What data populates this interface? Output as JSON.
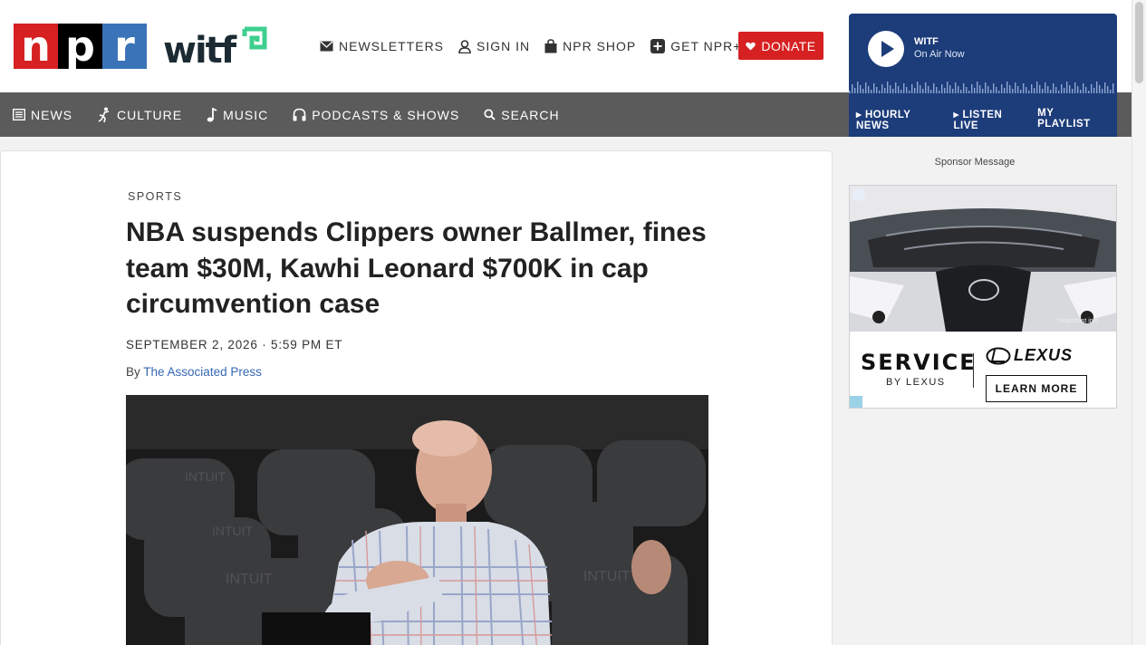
{
  "header": {
    "npr_logo": [
      "n",
      "p",
      "r"
    ],
    "station_logo": "witf",
    "util_nav": [
      {
        "label": "NEWSLETTERS",
        "icon": "mail-icon"
      },
      {
        "label": "SIGN IN",
        "icon": "user-icon"
      },
      {
        "label": "NPR SHOP",
        "icon": "shopping-bag-icon"
      },
      {
        "label": "GET NPR+",
        "icon": "plus-square-icon"
      }
    ],
    "donate_label": "DONATE"
  },
  "nav": {
    "items": [
      {
        "label": "NEWS",
        "icon": "news-icon"
      },
      {
        "label": "CULTURE",
        "icon": "culture-icon"
      },
      {
        "label": "MUSIC",
        "icon": "music-note-icon"
      },
      {
        "label": "PODCASTS & SHOWS",
        "icon": "headphones-icon"
      },
      {
        "label": "SEARCH",
        "icon": "search-icon"
      }
    ]
  },
  "player": {
    "station": "WITF",
    "status": "On Air Now",
    "links": [
      "▸ HOURLY NEWS",
      "▸ LISTEN LIVE",
      "MY PLAYLIST"
    ]
  },
  "article": {
    "section": "SPORTS",
    "headline": "NBA suspends Clippers owner Ballmer, fines team $30M, Kawhi Leonard $700K in cap circumvention case",
    "dateline": "SEPTEMBER 2, 2026 · 5:59 PM ET",
    "by_prefix": "By",
    "author": "The Associated Press"
  },
  "sidebar": {
    "sponsor_label": "Sponsor Message",
    "ad": {
      "headline": "SERVICE",
      "subline": "BY LEXUS",
      "brand": "LEXUS",
      "cta": "LEARN MORE",
      "disclaimer": "*Important info"
    }
  },
  "colors": {
    "npr_red": "#d62021",
    "npr_black": "#000000",
    "npr_blue": "#3a73b8",
    "nav_bg": "#5b5b5b",
    "player_bg": "#1c3c7a",
    "link_blue": "#3567b3"
  }
}
